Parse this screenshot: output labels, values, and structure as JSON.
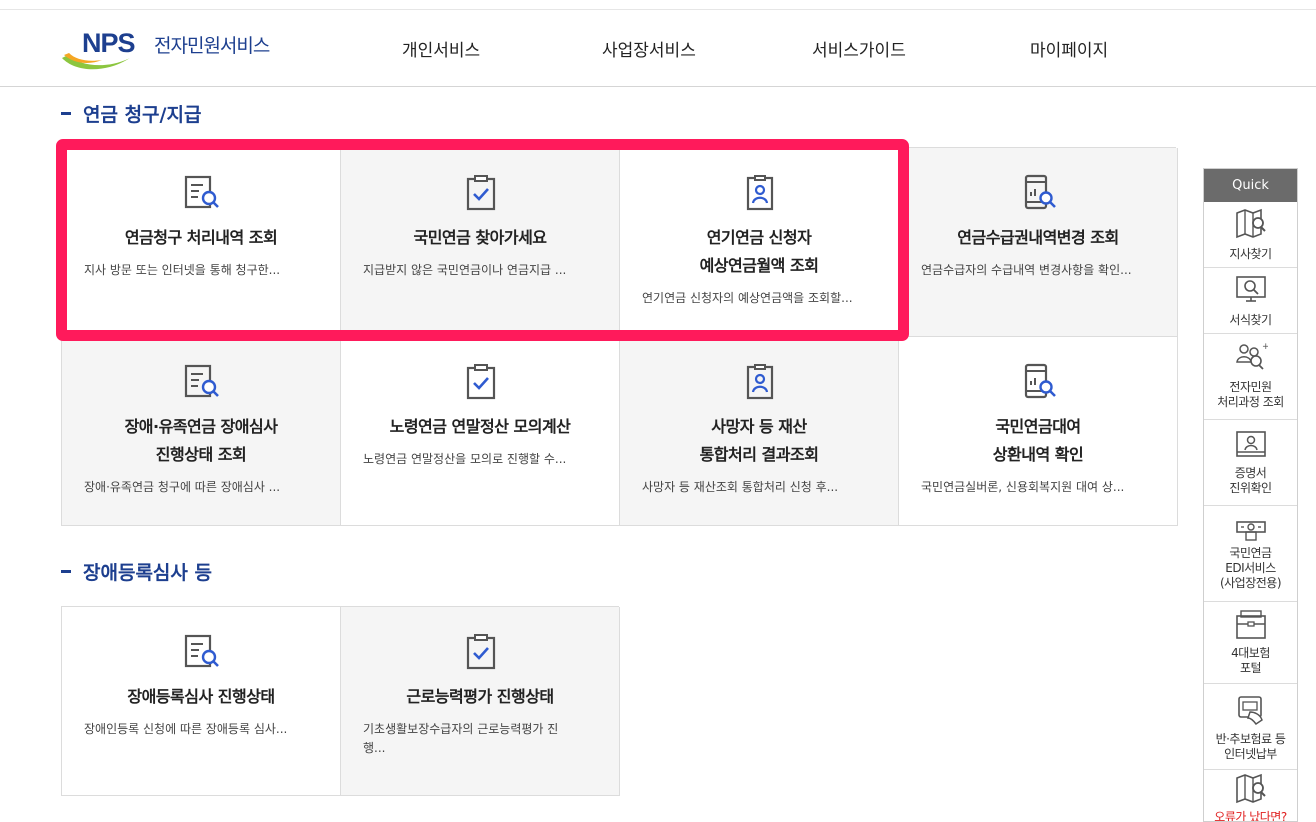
{
  "header": {
    "logo_text": "NPS",
    "logo_sub": "전자민원서비스",
    "nav": [
      "개인서비스",
      "사업장서비스",
      "서비스가이드",
      "마이페이지"
    ]
  },
  "sections": [
    {
      "title": "연금 청구/지급",
      "cards": [
        {
          "title1": "연금청구 처리내역 조회",
          "title2": "",
          "desc": "지사 방문 또는 인터넷을 통해 청구한...",
          "icon": "document-search-icon"
        },
        {
          "title1": "국민연금 찾아가세요",
          "title2": "",
          "desc": "지급받지 않은 국민연금이나 연금지급 ...",
          "icon": "clipboard-check-icon"
        },
        {
          "title1": "연기연금 신청자",
          "title2": "예상연금월액 조회",
          "desc": "연기연금 신청자의 예상연금액을 조회할...",
          "icon": "id-badge-icon"
        },
        {
          "title1": "연금수급권내역변경 조회",
          "title2": "",
          "desc": "연금수급자의 수급내역 변경사항을 확인...",
          "icon": "mobile-chart-search-icon"
        },
        {
          "title1": "장애·유족연금 장애심사",
          "title2": "진행상태 조회",
          "desc": "장애·유족연금 청구에 따른 장애심사 ...",
          "icon": "document-search-icon"
        },
        {
          "title1": "노령연금 연말정산 모의계산",
          "title2": "",
          "desc": "노령연금 연말정산을 모의로 진행할 수...",
          "icon": "clipboard-check-icon"
        },
        {
          "title1": "사망자 등 재산",
          "title2": "통합처리 결과조회",
          "desc": "사망자 등 재산조회 통합처리 신청 후...",
          "icon": "id-badge-icon"
        },
        {
          "title1": "국민연금대여",
          "title2": "상환내역 확인",
          "desc": "국민연금실버론, 신용회복지원 대여 상...",
          "icon": "mobile-chart-search-icon"
        }
      ]
    },
    {
      "title": "장애등록심사 등",
      "cards": [
        {
          "title1": "장애등록심사 진행상태",
          "title2": "",
          "desc": "장애인등록 신청에 따른 장애등록 심사...",
          "icon": "document-search-icon"
        },
        {
          "title1": "근로능력평가 진행상태",
          "title2": "",
          "desc": "기초생활보장수급자의 근로능력평가 진",
          "desc2": "행...",
          "icon": "clipboard-check-icon"
        }
      ]
    }
  ],
  "quick": {
    "title": "Quick",
    "items": [
      {
        "l1": "지사찾기",
        "l2": "",
        "l3": "",
        "icon": "map-search-icon"
      },
      {
        "l1": "서식찾기",
        "l2": "",
        "l3": "",
        "icon": "monitor-search-icon"
      },
      {
        "l1": "전자민원",
        "l2": "처리과정 조회",
        "l3": "",
        "icon": "people-search-icon"
      },
      {
        "l1": "증명서",
        "l2": "진위확인",
        "l3": "",
        "icon": "certificate-icon"
      },
      {
        "l1": "국민연금",
        "l2": "EDI서비스",
        "l3": "(사업장전용)",
        "icon": "edi-terminal-icon"
      },
      {
        "l1": "4대보험",
        "l2": "포털",
        "l3": "",
        "icon": "folder-icon"
      },
      {
        "l1": "반·추보험료 등",
        "l2": "인터넷납부",
        "l3": "",
        "icon": "card-payment-icon"
      },
      {
        "l1": "오류가 났다면?",
        "l2": "",
        "l3": "",
        "icon": "map-search-icon"
      }
    ]
  },
  "colors": {
    "brand": "#1d3f8f",
    "highlight": "#ff1a5b",
    "quick_head": "#6b6b6b"
  }
}
